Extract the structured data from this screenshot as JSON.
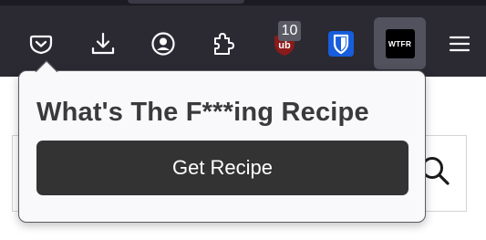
{
  "toolbar": {
    "buttons": [
      {
        "name": "pocket-icon"
      },
      {
        "name": "downloads-icon"
      },
      {
        "name": "account-icon"
      },
      {
        "name": "extensions-icon"
      },
      {
        "name": "ublock-icon"
      },
      {
        "name": "bitwarden-icon"
      },
      {
        "name": "wtfr-extension-icon"
      },
      {
        "name": "menu-icon"
      }
    ],
    "ublock_badge": "10",
    "wtfr_label": "WTFR"
  },
  "popup": {
    "title": "What's The F***ing Recipe",
    "button_label": "Get Recipe"
  },
  "colors": {
    "toolbar_bg": "#2b2a33",
    "popup_bg": "#f9f9fb",
    "button_bg": "#333333",
    "ublock_red": "#8b1a1a",
    "bitwarden_blue": "#175ddc"
  }
}
